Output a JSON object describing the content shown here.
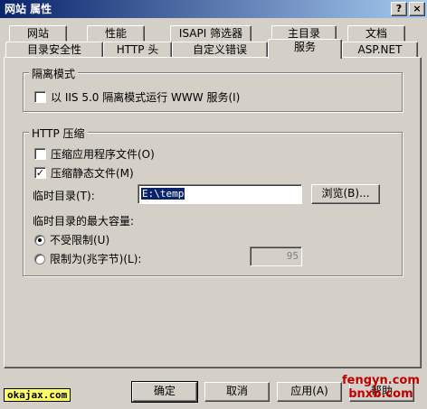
{
  "window": {
    "title": "网站 属性",
    "help_button": "?",
    "close_button": "×"
  },
  "tabs_back": [
    {
      "label": "网站",
      "name": "tab-website"
    },
    {
      "label": "性能",
      "name": "tab-performance"
    },
    {
      "label": "ISAPI 筛选器",
      "name": "tab-isapi-filters"
    },
    {
      "label": "主目录",
      "name": "tab-home-directory"
    },
    {
      "label": "文档",
      "name": "tab-documents"
    }
  ],
  "tabs_front": [
    {
      "label": "目录安全性",
      "name": "tab-directory-security"
    },
    {
      "label": "HTTP 头",
      "name": "tab-http-headers"
    },
    {
      "label": "自定义错误",
      "name": "tab-custom-errors"
    },
    {
      "label": "服务",
      "name": "tab-service",
      "active": true
    },
    {
      "label": "ASP.NET",
      "name": "tab-aspnet"
    }
  ],
  "isolation": {
    "legend": "隔离模式",
    "checkbox_label": "以 IIS 5.0 隔离模式运行 WWW 服务(I)",
    "checked": false
  },
  "compression": {
    "legend": "HTTP 压缩",
    "app_files_label": "压缩应用程序文件(O)",
    "app_files_checked": false,
    "static_files_label": "压缩静态文件(M)",
    "static_files_checked": true,
    "temp_dir_label": "临时目录(T):",
    "temp_dir_value": "E:\\temp",
    "browse_label": "浏览(B)...",
    "max_size_label": "临时目录的最大容量:",
    "unlimited_label": "不受限制(U)",
    "limit_label": "限制为(兆字节)(L):",
    "limit_value": "95",
    "selected_option": "unlimited"
  },
  "buttons": {
    "ok": "确定",
    "cancel": "取消",
    "apply": "应用(A)",
    "help": "帮助"
  },
  "watermarks": {
    "left": "okajax.com",
    "right_top": "fengyn.com",
    "right_bottom": "bnxb.com"
  }
}
